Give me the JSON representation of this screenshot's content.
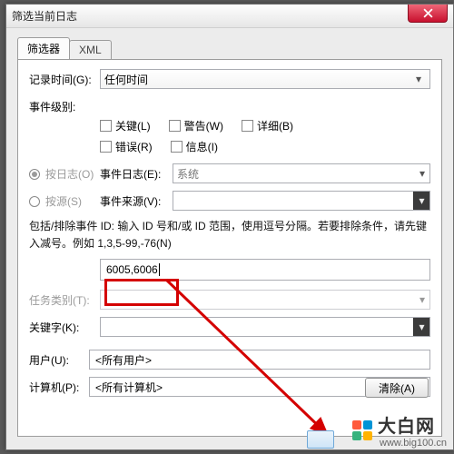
{
  "window": {
    "title": "筛选当前日志"
  },
  "close_icon": "x",
  "tabs": {
    "filter": "筛选器",
    "xml": "XML"
  },
  "time": {
    "label": "记录时间(G):",
    "value": "任何时间"
  },
  "level": {
    "label": "事件级别:",
    "critical": "关键(L)",
    "warning": "警告(W)",
    "verbose": "详细(B)",
    "error": "错误(R)",
    "info": "信息(I)"
  },
  "radio": {
    "bylog": "按日志(O)",
    "bysource": "按源(S)"
  },
  "eventlog": {
    "label": "事件日志(E):",
    "value": "系统"
  },
  "eventsource": {
    "label": "事件来源(V):",
    "value": ""
  },
  "idhelp": "包括/排除事件 ID: 输入 ID 号和/或 ID 范围，使用逗号分隔。若要排除条件，请先键入减号。例如 1,3,5-99,-76(N)",
  "idinput": "6005,6006",
  "task": {
    "label": "任务类别(T):"
  },
  "keyword": {
    "label": "关键字(K):"
  },
  "user": {
    "label": "用户(U):",
    "value": "<所有用户>"
  },
  "computer": {
    "label": "计算机(P):",
    "value": "<所有计算机>"
  },
  "clear": "清除(A)",
  "watermark": {
    "brand": "大白网",
    "url": "www.big100.cn"
  }
}
